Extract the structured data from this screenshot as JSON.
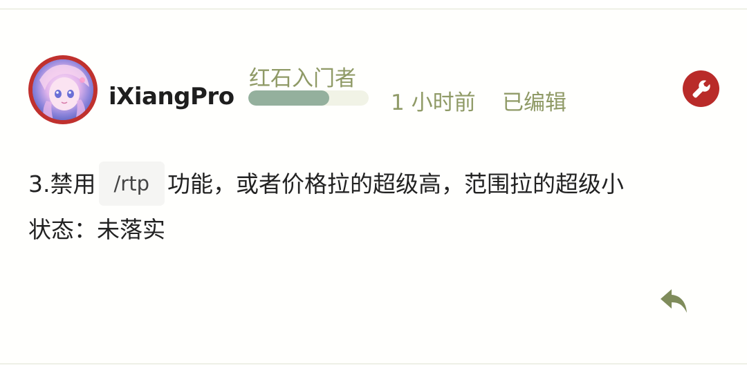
{
  "post": {
    "author": {
      "username": "iXiangPro",
      "rank_title": "红石入门者",
      "rank_progress": 0.67
    },
    "time_ago": "1 小时前",
    "edited_label": "已编辑",
    "content": {
      "line1_prefix": "3.禁用",
      "line1_code": "/rtp",
      "line1_suffix": "功能，或者价格拉的超级高，范围拉的超级小",
      "line2": "状态：未落实"
    }
  },
  "icons": {
    "wrench": "wrench-icon",
    "reply": "reply-icon"
  },
  "colors": {
    "accent_red": "#b92b29",
    "muted_olive": "#8f9a66",
    "progress_fill": "#94b09d"
  }
}
